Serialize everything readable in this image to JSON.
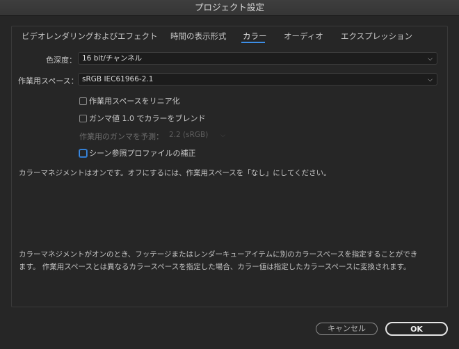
{
  "window": {
    "title": "プロジェクト設定"
  },
  "tabs": [
    {
      "label": "ビデオレンダリングおよびエフェクト",
      "active": false
    },
    {
      "label": "時間の表示形式",
      "active": false
    },
    {
      "label": "カラー",
      "active": true
    },
    {
      "label": "オーディオ",
      "active": false
    },
    {
      "label": "エクスプレッション",
      "active": false
    }
  ],
  "color": {
    "depth_label": "色深度：",
    "depth_value": "16 bit/チャンネル",
    "workspace_label": "作業用スペース：",
    "workspace_value": "sRGB IEC61966-2.1",
    "linearize_label": "作業用スペースをリニア化",
    "blend_label": "ガンマ値 1.0 でカラーをブレンド",
    "gamma_predict_label": "作業用のガンマを予測：",
    "gamma_predict_value": "2.2 (sRGB)",
    "scene_ref_label": "シーン参照プロファイルの補正",
    "status_text": "カラーマネジメントはオンです。オフにするには、作業用スペースを「なし」にしてください。",
    "description_line1": "カラーマネジメントがオンのとき、フッテージまたはレンダーキューアイテムに別のカラースペースを指定することができ",
    "description_line2": "ます。 作業用スペースとは異なるカラースペースを指定した場合、カラー値は指定したカラースペースに変換されます。"
  },
  "buttons": {
    "cancel_label": "キャンセル",
    "ok_label": "OK"
  },
  "icons": {
    "dropdown": "chevron-down-icon"
  },
  "colors": {
    "accent": "#3d8ee6"
  }
}
